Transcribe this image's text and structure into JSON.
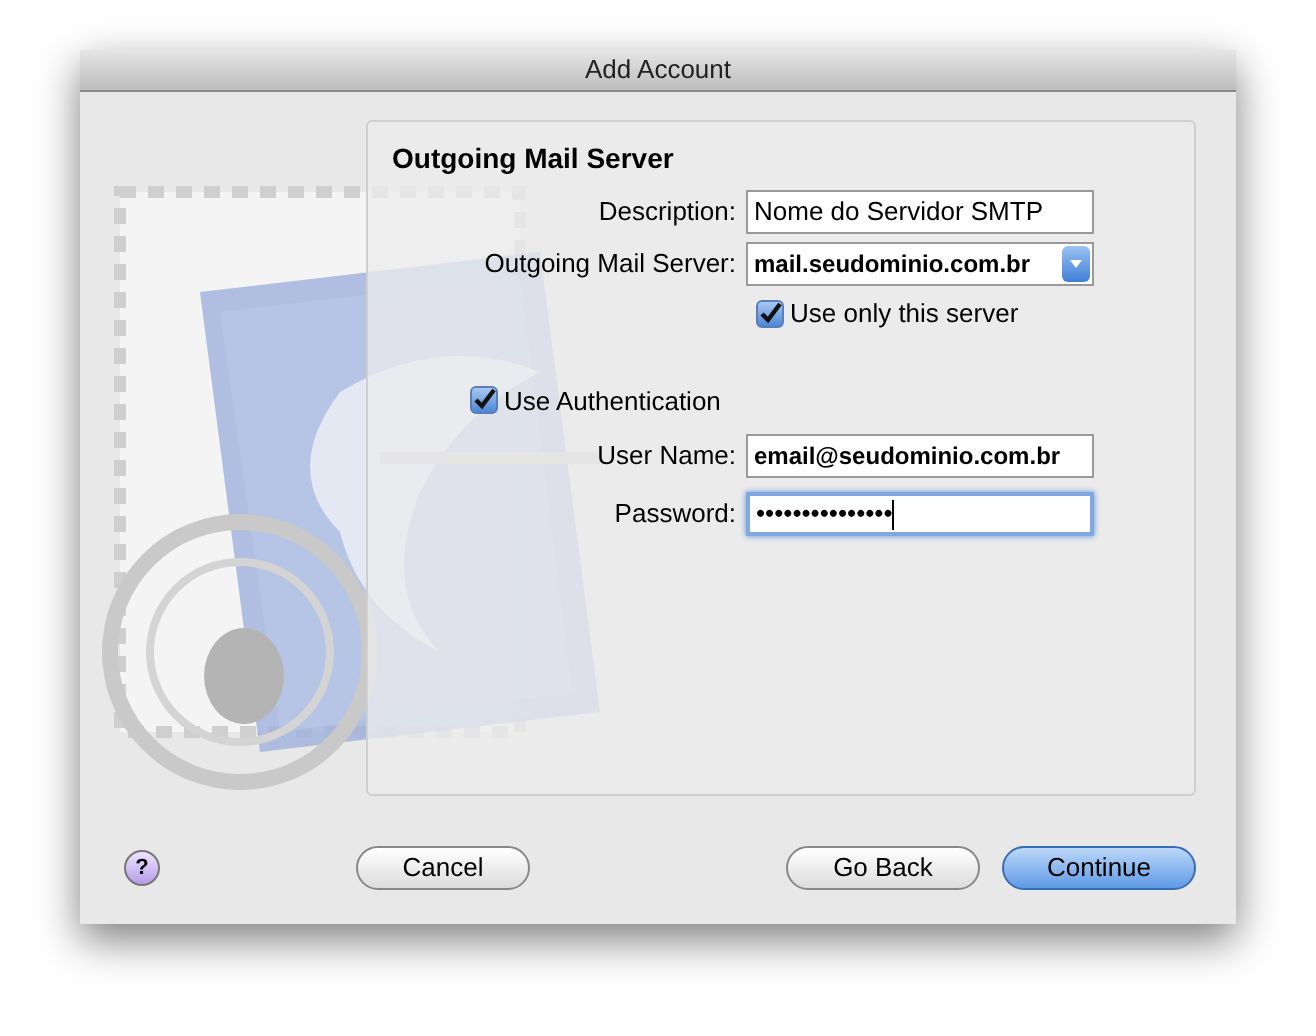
{
  "window": {
    "title": "Add Account"
  },
  "section": {
    "title": "Outgoing Mail Server"
  },
  "description": {
    "label": "Description:",
    "value": "Nome do Servidor SMTP",
    "focused": false
  },
  "server": {
    "label": "Outgoing Mail Server:",
    "value": "mail.seudominio.com.br"
  },
  "only_server": {
    "label": "Use only this server",
    "checked": true
  },
  "authentication": {
    "label": "Use Authentication",
    "checked": true
  },
  "user_name": {
    "label": "User Name:",
    "value": "email@seudominio.com.br",
    "focused": false
  },
  "password": {
    "label": "Password:",
    "value": "•••••••••••••••",
    "focused": true
  },
  "help": {
    "label": "?"
  },
  "buttons": [
    {
      "label": "Cancel",
      "default": false
    },
    {
      "label": "Go Back",
      "default": false
    },
    {
      "label": "Continue",
      "default": true
    }
  ]
}
